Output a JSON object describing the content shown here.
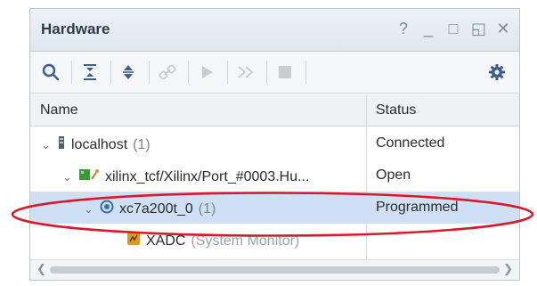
{
  "window": {
    "title": "Hardware",
    "controls": {
      "help": "?",
      "minimize": "_",
      "maximize": "□",
      "restore": "◱",
      "close": "✕"
    }
  },
  "toolbar": {
    "icons": [
      "search-icon",
      "collapse-all-icon",
      "expand-all-icon",
      "link-icon",
      "run-icon",
      "fast-forward-icon",
      "stop-icon",
      "gear-icon"
    ]
  },
  "columns": {
    "name": "Name",
    "status": "Status"
  },
  "tree": {
    "host": {
      "label": "localhost",
      "count": "(1)",
      "status": "Connected"
    },
    "target": {
      "label": "xilinx_tcf/Xilinx/Port_#0003.Hu...",
      "status": "Open"
    },
    "device": {
      "label": "xc7a200t_0",
      "count": "(1)",
      "status": "Programmed"
    },
    "monitor": {
      "label": "XADC",
      "detail": "(System Monitor)",
      "status": ""
    }
  },
  "colors": {
    "selection": "#cfe0f5",
    "annotation": "#d8192a",
    "accent": "#3b6ea8"
  }
}
